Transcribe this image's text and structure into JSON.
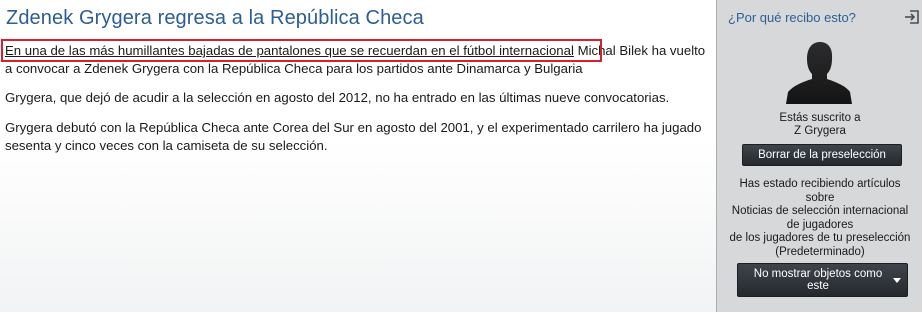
{
  "article": {
    "title": "Zdenek Grygera regresa a la República Checa",
    "para1_link": "En una de las más humillantes bajadas de pantalones que se recuerdan en el fútbol internacional",
    "para1_rest": " Michal Bilek ha vuelto a convocar a Zdenek Grygera con la República Checa para los partidos ante Dinamarca y Bulgaria",
    "para2": "Grygera, que dejó de acudir a la selección en agosto del 2012, no ha entrado en las últimas nueve convocatorias.",
    "para3": "Grygera debutó con la República Checa ante Corea del Sur en agosto del 2001, y el experimentado carrilero ha jugado sesenta y cinco veces con la camiseta de su selección."
  },
  "sidebar": {
    "why_link": "¿Por qué recibo esto?",
    "subscribed_label": "Estás suscrito a",
    "subscribed_name": "Z Grygera",
    "remove_button": "Borrar de la preselección",
    "receiving_lines": [
      "Has estado recibiendo artículos",
      "sobre",
      "Noticias de selección internacional",
      "de jugadores",
      "de los jugadores de tu preselección",
      "(Predeterminado)"
    ],
    "dont_show_button": "No mostrar objetos como este"
  },
  "colors": {
    "title": "#2c5d96",
    "highlight": "#d6202e",
    "sidebar_bg": "#d6d8da",
    "button_bg": "#2f3338"
  }
}
